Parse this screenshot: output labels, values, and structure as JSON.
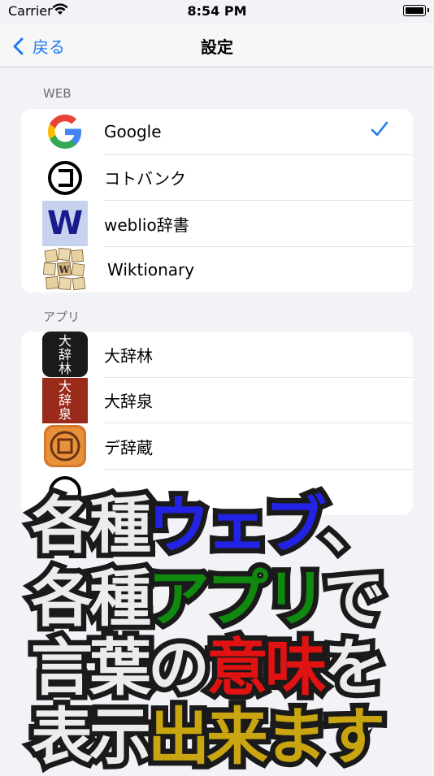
{
  "status": {
    "carrier": "Carrier",
    "time": "8:54 PM"
  },
  "nav": {
    "back_label": "戻る",
    "title": "設定"
  },
  "sections": [
    {
      "header": "WEB",
      "items": [
        {
          "label": "Google",
          "icon": "google-icon",
          "checked": true
        },
        {
          "label": "コトバンク",
          "icon": "kotobank-icon",
          "checked": false
        },
        {
          "label": "weblio辞書",
          "icon": "weblio-icon",
          "checked": false
        },
        {
          "label": "Wiktionary",
          "icon": "wiktionary-icon",
          "checked": false
        }
      ]
    },
    {
      "header": "アプリ",
      "items": [
        {
          "label": "大辞林",
          "icon": "daijirin-icon",
          "checked": false
        },
        {
          "label": "大辞泉",
          "icon": "daijisen-icon",
          "checked": false
        },
        {
          "label": "デ辞蔵",
          "icon": "dejizo-icon",
          "checked": false
        }
      ]
    }
  ],
  "banner": {
    "line1": {
      "a": "各種",
      "b": "ウェブ",
      "c": "、"
    },
    "line2": {
      "a": "各種",
      "b": "アプリ",
      "c": "で"
    },
    "line3": {
      "a": "言葉の",
      "b": "意味",
      "c": "を"
    },
    "line4": {
      "a": "表示",
      "b": "出来ます"
    }
  },
  "colors": {
    "accent": "#1d7bf3",
    "blue": "#2323e6",
    "green": "#0f8a0f",
    "red": "#e11212",
    "yellow": "#c8a511"
  }
}
